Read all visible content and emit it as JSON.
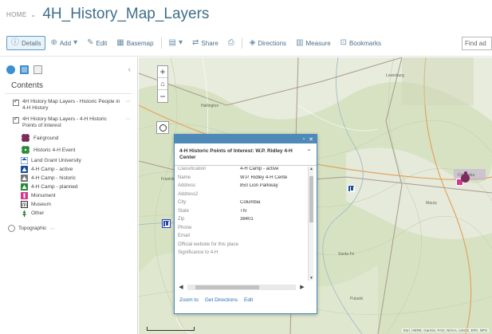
{
  "header": {
    "breadcrumb": "HOME",
    "breadcrumb_chevron": "⌄",
    "title": "4H_History_Map_Layers"
  },
  "toolbar": {
    "details": "Details",
    "add": "Add",
    "edit": "Edit",
    "basemap": "Basemap",
    "share": "Share",
    "directions": "Directions",
    "measure": "Measure",
    "bookmarks": "Bookmarks",
    "find_placeholder": "Find ad"
  },
  "sidebar": {
    "contents_title": "Contents",
    "layers": [
      {
        "label": "4H History Map Layers - Historic People in 4-H History"
      },
      {
        "label": "4H History Map Layers - 4-H Historic Points of Interest"
      }
    ],
    "legend": [
      {
        "label": "Fairground",
        "icon": "fairground-icon",
        "color": "#7b2c5b"
      },
      {
        "label": "Historic 4-H Event",
        "icon": "clover-icon",
        "color": "#2e8b3d"
      },
      {
        "label": "Land Grant University",
        "icon": "university-icon",
        "color": "#2a55a8"
      },
      {
        "label": "4-H Camp - active",
        "icon": "camp-active-icon",
        "color": "#1f4e99"
      },
      {
        "label": "4-H Camp - historic",
        "icon": "camp-historic-icon",
        "color": "#777777"
      },
      {
        "label": "4-H Camp - planned",
        "icon": "camp-planned-icon",
        "color": "#2e8b3d"
      },
      {
        "label": "Monument",
        "icon": "monument-icon",
        "color": "#d23a8e"
      },
      {
        "label": "Museum",
        "icon": "museum-icon",
        "color": "#333333"
      },
      {
        "label": "Other",
        "icon": "other-icon",
        "color": "#2e8b3d"
      }
    ],
    "basemap_label": "Topographic"
  },
  "map": {
    "labels": [
      "Hallington",
      "Columbia",
      "Franklin",
      "Maury",
      "Lewisburg",
      "Pulaski",
      "Santa Fe"
    ],
    "attribution": "Esri, HERE, Garmin, FAO, NOAA, USGS, EPA, NPS"
  },
  "popup": {
    "title": "4-H Historic Points of Interest: W.P. Ridley 4-H Center",
    "fields": [
      {
        "label": "Classification",
        "value": "4-H Camp - active"
      },
      {
        "label": "Name",
        "value": "W.P. Ridley 4-H Cente"
      },
      {
        "label": "Address",
        "value": "850 Lion Parkway"
      },
      {
        "label": "Address2",
        "value": ""
      },
      {
        "label": "City",
        "value": "Columbia"
      },
      {
        "label": "State",
        "value": "TN"
      },
      {
        "label": "Zip",
        "value": "38401"
      },
      {
        "label": "Phone",
        "value": ""
      },
      {
        "label": "Email",
        "value": ""
      },
      {
        "label": "Official website for this place",
        "value": ""
      },
      {
        "label": "Significance to 4-H",
        "value": ""
      }
    ],
    "zoom_to": "Zoom to",
    "get_directions": "Get Directions",
    "edit": "Edit"
  }
}
